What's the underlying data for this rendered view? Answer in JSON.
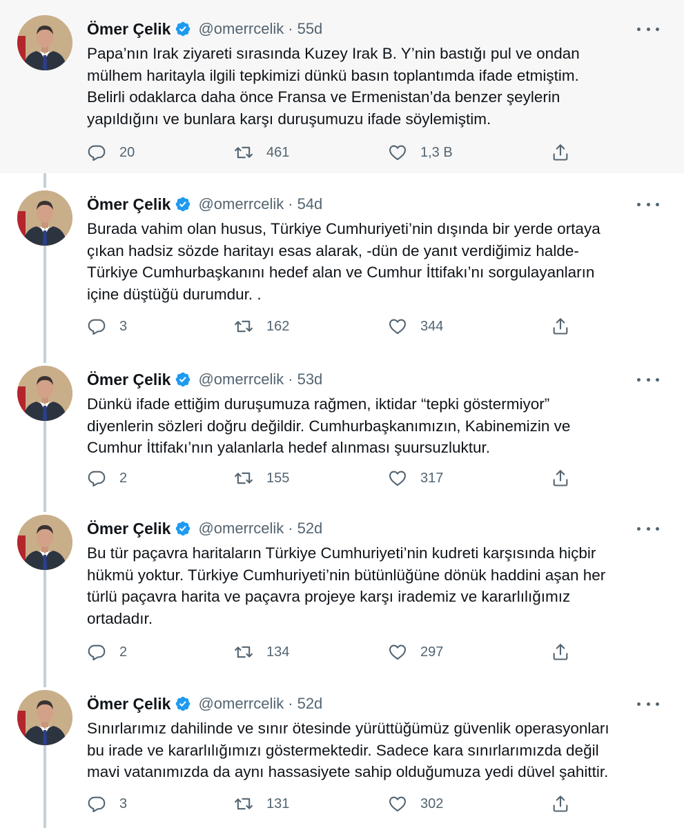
{
  "tweets": [
    {
      "name": "Ömer Çelik",
      "handle": "@omerrcelik",
      "separator": "·",
      "time": "55d",
      "text": "Papa’nın Irak ziyareti sırasında Kuzey Irak B. Y’nin bastığı pul ve ondan\nmülhem haritayla ilgili tepkimizi dünkü basın toplantımda ifade etmiştim.\nBelirli odaklarca daha önce Fransa ve Ermenistan’da benzer şeylerin\nyapıldığını ve bunlara karşı duruşumuzu ifade söylemiştim.",
      "replies": "20",
      "retweets": "461",
      "likes": "1,3 B"
    },
    {
      "name": "Ömer Çelik",
      "handle": "@omerrcelik",
      "separator": "·",
      "time": "54d",
      "text": "Burada vahim olan husus, Türkiye Cumhuriyeti’nin dışında bir yerde ortaya\nçıkan hadsiz sözde haritayı esas alarak, -dün de yanıt verdiğimiz halde-\nTürkiye Cumhurbaşkanını hedef alan ve Cumhur İttifakı’nı sorgulayanların\niçine düştüğü durumdur. .",
      "replies": "3",
      "retweets": "162",
      "likes": "344"
    },
    {
      "name": "Ömer Çelik",
      "handle": "@omerrcelik",
      "separator": "·",
      "time": "53d",
      "text": "Dünkü ifade ettiğim duruşumuza rağmen, iktidar “tepki göstermiyor”\ndiyenlerin sözleri doğru değildir. Cumhurbaşkanımızın, Kabinemizin ve\nCumhur İttifakı’nın yalanlarla hedef alınması şuursuzluktur.",
      "replies": "2",
      "retweets": "155",
      "likes": "317"
    },
    {
      "name": "Ömer Çelik",
      "handle": "@omerrcelik",
      "separator": "·",
      "time": "52d",
      "text": "Bu tür paçavra haritaların Türkiye Cumhuriyeti’nin kudreti karşısında hiçbir\nhükmü yoktur. Türkiye Cumhuriyeti’nin bütünlüğüne dönük haddini aşan her\ntürlü paçavra harita ve paçavra projeye karşı irademiz ve kararlılığımız\nortadadır.",
      "replies": "2",
      "retweets": "134",
      "likes": "297"
    },
    {
      "name": "Ömer Çelik",
      "handle": "@omerrcelik",
      "separator": "·",
      "time": "52d",
      "text": "Sınırlarımız dahilinde ve sınır ötesinde yürüttüğümüz güvenlik operasyonları\nbu irade ve kararlılığımızı göstermektedir. Sadece kara sınırlarımızda değil\nmavi vatanımızda da aynı hassasiyete sahip olduğumuza yedi düvel şahittir.",
      "replies": "3",
      "retweets": "131",
      "likes": "302"
    }
  ],
  "icons": {
    "verified": "verified-badge-icon",
    "more": "more-options-icon",
    "reply": "reply-icon",
    "retweet": "retweet-icon",
    "like": "heart-icon",
    "share": "share-icon"
  },
  "colors": {
    "verified": "#1d9bf0",
    "secondary_text": "#536471",
    "highlight_background": "#f7f7f7",
    "thread_line": "#c4cfd6"
  }
}
